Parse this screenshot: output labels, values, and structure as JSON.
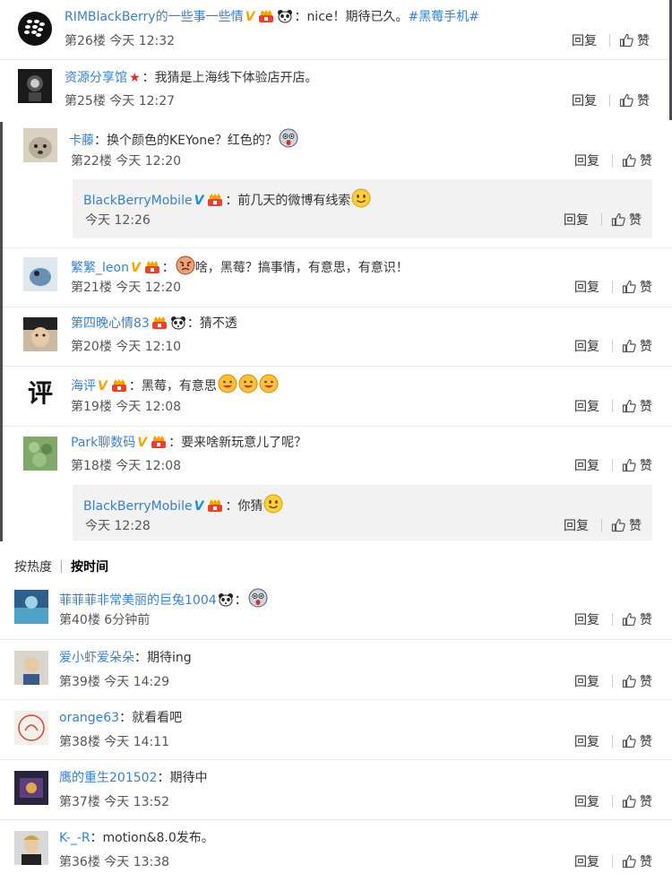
{
  "sec1": {
    "c1": {
      "user": "RIMBlackBerry的一些事一些情",
      "sep": "：",
      "text": "nice！期待已久。",
      "topic": "#黑莓手机#",
      "floor": "第26楼",
      "time": "今天 12:32",
      "reply": "回复",
      "like": "赞"
    },
    "c2": {
      "user": "资源分享馆",
      "sep": "：",
      "text": "我猜是上海线下体验店开店。",
      "floor": "第25楼",
      "time": "今天 12:27",
      "reply": "回复",
      "like": "赞"
    }
  },
  "sec2": {
    "c1": {
      "user": "卡藤",
      "sep": "：",
      "text": "换个颜色的KEYone？红色的？",
      "floor": "第22楼",
      "time": "今天 12:20",
      "reply": "回复",
      "like": "赞"
    },
    "c1r": {
      "user": "BlackBerryMobile",
      "sep": "：",
      "text": "前几天的微博有线索",
      "time": "今天 12:26",
      "reply": "回复",
      "like": "赞"
    },
    "c2": {
      "user": "繁繁_leon",
      "sep": "：",
      "text": "啥，黑莓？搞事情，有意思，有意识！",
      "floor": "第21楼",
      "time": "今天 12:20",
      "reply": "回复",
      "like": "赞"
    },
    "c3": {
      "user": "第四晚心情83",
      "sep": "：",
      "text": "猜不透",
      "floor": "第20楼",
      "time": "今天 12:10",
      "reply": "回复",
      "like": "赞"
    },
    "c4": {
      "user": "海评",
      "sep": "：",
      "text": "黑莓，有意思",
      "floor": "第19楼",
      "time": "今天 12:08",
      "reply": "回复",
      "like": "赞",
      "avatar_char": "评"
    },
    "c5": {
      "user": "Park聊数码",
      "sep": "：",
      "text": "要来啥新玩意儿了呢？",
      "floor": "第18楼",
      "time": "今天 12:08",
      "reply": "回复",
      "like": "赞"
    },
    "c5r": {
      "user": "BlackBerryMobile",
      "sep": "：",
      "text": "你猜",
      "time": "今天 12:28",
      "reply": "回复",
      "like": "赞"
    }
  },
  "sec3": {
    "sort_hot": "按热度",
    "sort_time": "按时间",
    "c1": {
      "user": "菲菲菲非常美丽的巨兔1004",
      "sep": "：",
      "floor": "第40楼",
      "time": "6分钟前",
      "reply": "回复",
      "like": "赞"
    },
    "c2": {
      "user": "爱小虾爱朵朵",
      "sep": "：",
      "text": "期待ing",
      "floor": "第39楼",
      "time": "今天 14:29",
      "reply": "回复",
      "like": "赞"
    },
    "c3": {
      "user": "orange63",
      "sep": "：",
      "text": "就看看吧",
      "floor": "第38楼",
      "time": "今天 14:11",
      "reply": "回复",
      "like": "赞"
    },
    "c4": {
      "user": "鹰的重生201502",
      "sep": "：",
      "text": "期待中",
      "floor": "第37楼",
      "time": "今天 13:52",
      "reply": "回复",
      "like": "赞"
    },
    "c5": {
      "user": "K-_-R",
      "sep": "：",
      "text": "motion&8.0发布。",
      "floor": "第36楼",
      "time": "今天 13:38",
      "reply": "回复",
      "like": "赞"
    }
  },
  "icons": {
    "verified_v": "V",
    "star": "★",
    "thumb": "thumb-up-icon",
    "level": "member-level-icon",
    "panda": "panda-badge-icon",
    "smile": "smile-emoji-icon",
    "surprise": "surprise-emoji-icon"
  },
  "colors": {
    "username": "#3b7fc4",
    "verified_orange": "#f6a400",
    "verified_blue": "#1e90d9",
    "star": "#e0282e",
    "reply_bg": "#f2f2f2"
  }
}
